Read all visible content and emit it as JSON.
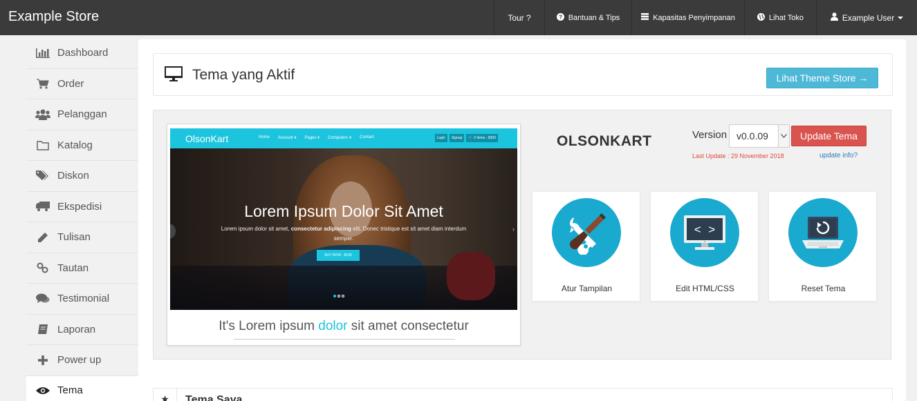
{
  "topbar": {
    "brand": "Example Store",
    "nav": [
      {
        "label": "Tour ?",
        "icon": ""
      },
      {
        "label": "Bantuan & Tips",
        "icon": "question-circle-icon"
      },
      {
        "label": "Kapasitas Penyimpanan",
        "icon": "server-icon"
      },
      {
        "label": "Lihat Toko",
        "icon": "globe-icon"
      },
      {
        "label": "Example User",
        "icon": "user-icon"
      }
    ]
  },
  "sidebar": {
    "items": [
      {
        "label": "Dashboard",
        "icon": "bar-chart-icon"
      },
      {
        "label": "Order",
        "icon": "cart-icon"
      },
      {
        "label": "Pelanggan",
        "icon": "users-icon"
      },
      {
        "label": "Katalog",
        "icon": "folder-icon"
      },
      {
        "label": "Diskon",
        "icon": "tags-icon"
      },
      {
        "label": "Ekspedisi",
        "icon": "truck-icon"
      },
      {
        "label": "Tulisan",
        "icon": "pencil-icon"
      },
      {
        "label": "Tautan",
        "icon": "link-icon"
      },
      {
        "label": "Testimonial",
        "icon": "comments-icon"
      },
      {
        "label": "Laporan",
        "icon": "book-icon"
      },
      {
        "label": "Power up",
        "icon": "plus-icon"
      },
      {
        "label": "Tema",
        "icon": "eye-icon",
        "active": true
      }
    ]
  },
  "main": {
    "active_title": "Tema yang Aktif",
    "store_button": "Lihat Theme Store →",
    "theme": {
      "name": "OLSONKART",
      "version_label": "Version",
      "version_value": "v0.0.09",
      "update_button": "Update Tema",
      "last_update": "Last Update : 29 November 2018",
      "update_info": "update info?"
    },
    "preview": {
      "brand": "OlsonKart",
      "links": [
        "Home",
        "Account ▾",
        "Pages ▾",
        "Computers ▾",
        "Contact"
      ],
      "buttons": [
        "Login",
        "Signup",
        "🛒 2 Items - $300"
      ],
      "hero_title": "Lorem Ipsum Dolor Sit Amet",
      "hero_sub_1": "Lorem ipsum dolor sit amet,",
      "hero_sub_bold": "consectetur adipiscing",
      "hero_sub_2": "elit. Donec tristique est sit amet diam interdum semper.",
      "hero_button": "BUY NOW - $199",
      "tagline_1": "It's Lorem ipsum",
      "tagline_hl": "dolor",
      "tagline_2": "sit amet consectetur"
    },
    "actions": [
      {
        "label": "Atur Tampilan",
        "icon": "tools-icon"
      },
      {
        "label": "Edit HTML/CSS",
        "icon": "code-monitor-icon"
      },
      {
        "label": "Reset Tema",
        "icon": "reset-laptop-icon"
      }
    ],
    "section2_title": "Tema Saya"
  },
  "colors": {
    "topbar": "#3b3b3b",
    "accent": "#1aaad0",
    "store_button": "#4eb8d7",
    "update_button": "#d9534f"
  }
}
